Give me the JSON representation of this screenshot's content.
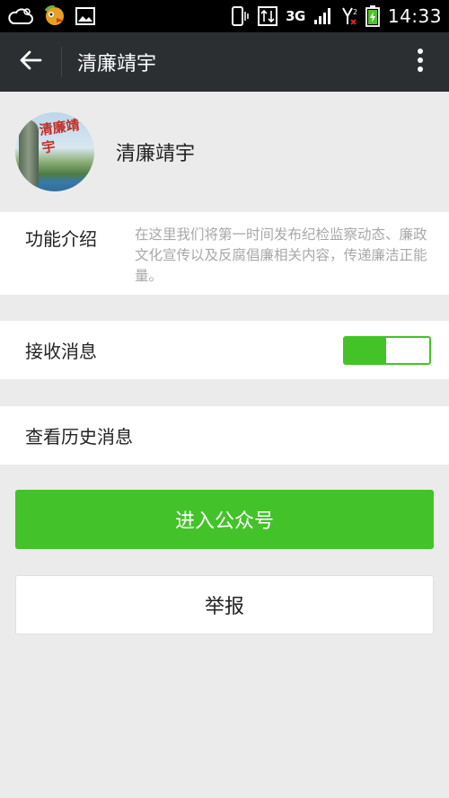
{
  "status_bar": {
    "network": "3G",
    "sim_label": "2",
    "time": "14:33",
    "icons": [
      "cloud-icon",
      "bird-icon",
      "image-icon",
      "phone-vibrate-icon",
      "data-transfer-icon",
      "signal-icon",
      "sim-icon",
      "battery-icon"
    ]
  },
  "action_bar": {
    "title": "清廉靖宇",
    "back_icon": "arrow-left-icon",
    "more_icon": "more-vertical-icon"
  },
  "profile": {
    "name": "清廉靖宇",
    "avatar_text": "清廉靖宇"
  },
  "intro": {
    "label": "功能介绍",
    "text": "在这里我们将第一时间发布纪检监察动态、廉政文化宣传以及反腐倡廉相关内容，传递廉洁正能量。"
  },
  "receive": {
    "label": "接收消息",
    "enabled": true,
    "accent": "#44c328"
  },
  "history": {
    "label": "查看历史消息"
  },
  "buttons": {
    "enter_label": "进入公众号",
    "report_label": "举报",
    "enter_color": "#44c22a"
  }
}
